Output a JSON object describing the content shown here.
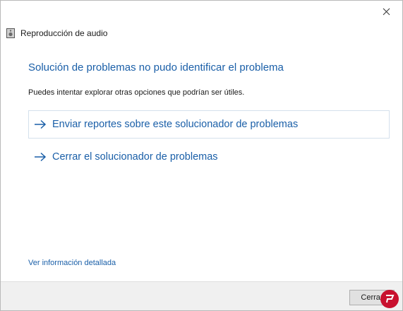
{
  "window": {
    "title": "Reproducción de audio",
    "close_glyph": "close-icon"
  },
  "main": {
    "heading": "Solución de problemas no pudo identificar el problema",
    "subtext": "Puedes intentar explorar otras opciones que podrían ser útiles.",
    "options": [
      {
        "label": "Enviar reportes sobre este solucionador de problemas"
      },
      {
        "label": "Cerrar el solucionador de problemas"
      }
    ],
    "details_link": "Ver información detallada"
  },
  "footer": {
    "close_button": "Cerrar"
  },
  "colors": {
    "link": "#1a5fa8",
    "background": "#ffffff",
    "footer": "#f0f0f0"
  }
}
